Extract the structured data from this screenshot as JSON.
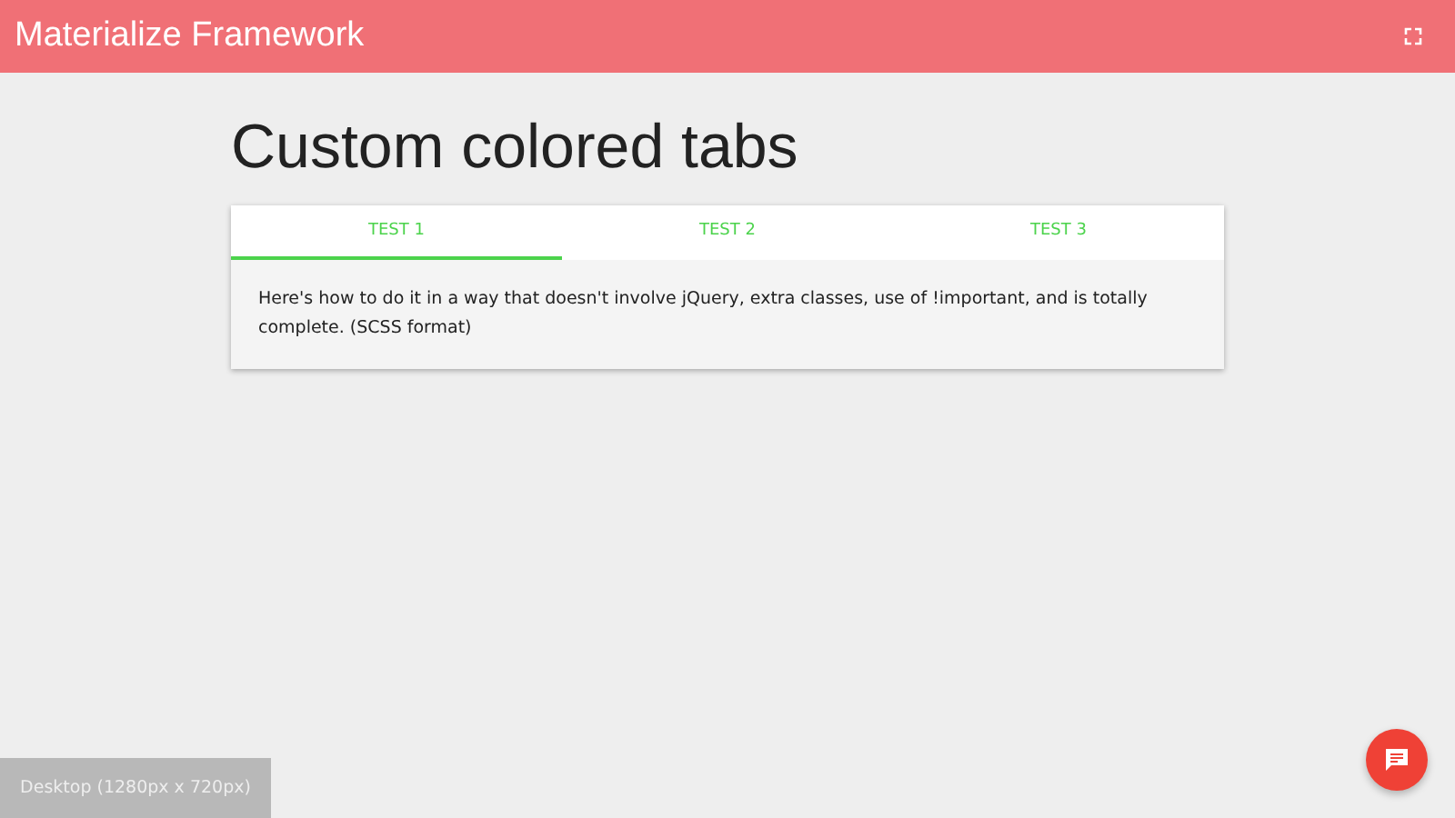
{
  "header": {
    "title": "Materialize Framework"
  },
  "heading": "Custom colored tabs",
  "tabs": [
    {
      "label": "TEST 1",
      "selected": true
    },
    {
      "label": "TEST 2",
      "selected": false
    },
    {
      "label": "TEST 3",
      "selected": false
    }
  ],
  "content": "Here's how to do it in a way that doesn't involve jQuery, extra classes, use of !important, and is totally complete. (SCSS format)",
  "viewport_badge": "Desktop (1280px x 720px)"
}
